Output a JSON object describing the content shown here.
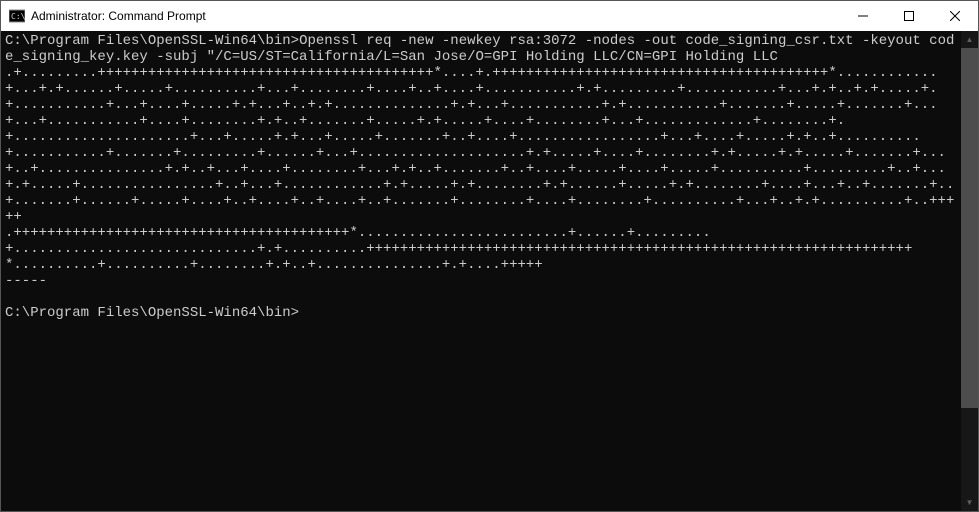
{
  "titlebar": {
    "title": "Administrator: Command Prompt"
  },
  "terminal": {
    "prompt1": "C:\\Program Files\\OpenSSL-Win64\\bin>",
    "command": "Openssl req -new -newkey rsa:3072 -nodes -out code_signing_csr.txt -keyout code_signing_key.key -subj \"/C=US/ST=California/L=San Jose/O=GPI Holding LLC/CN=GPI Holding LLC",
    "output": ".+.........++++++++++++++++++++++++++++++++++++++++*....+.++++++++++++++++++++++++++++++++++++++++*............+...+.+......+.....+..........+...+........+....+..+....+...........+.+.........+...........+...+.+..+.+.....+.+...........+...+....+.....+.+...+..+.+..............+.+...+...........+.+...........+.......+.....+.......+...+...+...........+....+........+.+..+.......+.....+.+.....+....+........+...+.............+........+.+.....................+...+.....+.+...+.....+.......+..+....+.................+...+....+.....+.+..+..........+...........+.......+.........+......+...+....................+.+.....+....+........+.+.....+.+.....+.......+...+..+...............+.+..+...+....+........+...+.+..+.......+..+....+.....+....+.....+..........+.........+..+...+.+.....+................+..+...+............+.+.....+.+........+.+......+.....+.+........+....+...+..+.......+..+.......+......+.....+....+..+....+..+....+..+.......+........+....+........+..........+...+..+.+..........+..+++++\n.++++++++++++++++++++++++++++++++++++++++*.........................+......+.........+.............................+.+..........+++++++++++++++++++++++++++++++++++++++++++++++++++++++++++++++++*..........+..........+........+.+..+...............+.+....+++++\n-----",
    "prompt2": "C:\\Program Files\\OpenSSL-Win64\\bin>"
  }
}
